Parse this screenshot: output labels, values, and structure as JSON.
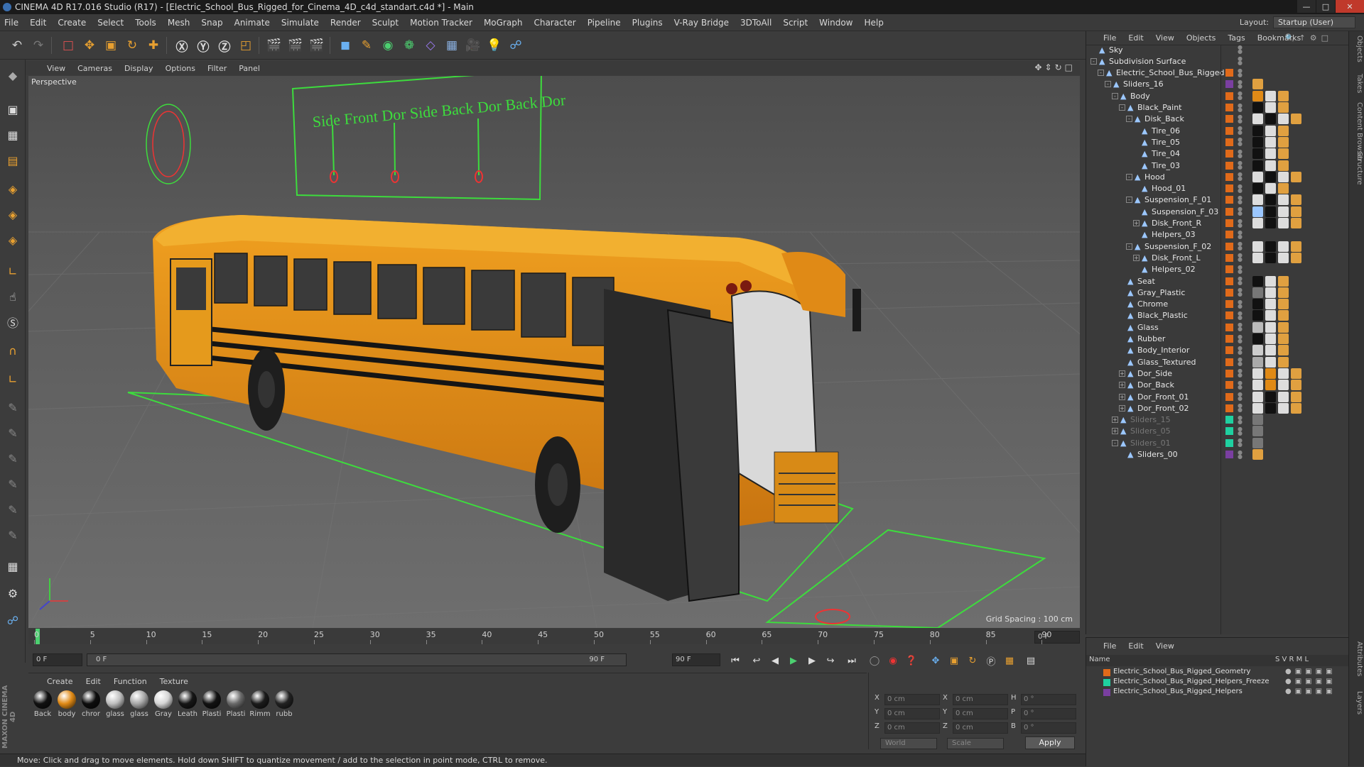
{
  "title": "CINEMA 4D R17.016 Studio (R17) - [Electric_School_Bus_Rigged_for_Cinema_4D_c4d_standart.c4d *] - Main",
  "menubar": [
    "File",
    "Edit",
    "Create",
    "Select",
    "Tools",
    "Mesh",
    "Snap",
    "Animate",
    "Simulate",
    "Render",
    "Sculpt",
    "Motion Tracker",
    "MoGraph",
    "Character",
    "Pipeline",
    "Plugins",
    "V-Ray Bridge",
    "3DToAll",
    "Script",
    "Window",
    "Help"
  ],
  "layout": {
    "label": "Layout:",
    "value": "Startup (User)"
  },
  "viewport": {
    "menu": [
      "View",
      "Cameras",
      "Display",
      "Options",
      "Filter",
      "Panel"
    ],
    "label": "Perspective",
    "grid_spacing": "Grid Spacing : 100 cm",
    "rig_text": "Side Front Dor  Side Back Dor  Back Dor"
  },
  "timeline": {
    "ticks": [
      "0",
      "5",
      "10",
      "15",
      "20",
      "25",
      "30",
      "35",
      "40",
      "45",
      "50",
      "55",
      "60",
      "65",
      "70",
      "75",
      "80",
      "85",
      "90"
    ],
    "end_frame_label": "0 F"
  },
  "transport": {
    "start": "0 F",
    "slider_start": "0 F",
    "slider_end": "90 F",
    "end": "90 F"
  },
  "materials": {
    "menu": [
      "Create",
      "Edit",
      "Function",
      "Texture"
    ],
    "items": [
      {
        "name": "Back",
        "color": "#111111"
      },
      {
        "name": "body",
        "color": "#e08a16"
      },
      {
        "name": "chror",
        "color": "#0d0d0d"
      },
      {
        "name": "glass",
        "color": "#bfbfbf"
      },
      {
        "name": "glass",
        "color": "#a8a8a8"
      },
      {
        "name": "Gray",
        "color": "#d5d5d5"
      },
      {
        "name": "Leath",
        "color": "#161616"
      },
      {
        "name": "Plasti",
        "color": "#121212"
      },
      {
        "name": "Plasti",
        "color": "#6a6a6a"
      },
      {
        "name": "Rimm",
        "color": "#1b1b1b"
      },
      {
        "name": "rubb",
        "color": "#222222"
      }
    ]
  },
  "coordinates": {
    "rows": [
      {
        "a": "X",
        "v1": "0 cm",
        "b": "X",
        "v2": "0 cm",
        "c": "H",
        "v3": "0 °"
      },
      {
        "a": "Y",
        "v1": "0 cm",
        "b": "Y",
        "v2": "0 cm",
        "c": "P",
        "v3": "0 °"
      },
      {
        "a": "Z",
        "v1": "0 cm",
        "b": "Z",
        "v2": "0 cm",
        "c": "B",
        "v3": "0 °"
      }
    ],
    "world": "World",
    "scale": "Scale",
    "apply": "Apply"
  },
  "status": "Move: Click and drag to move elements. Hold down SHIFT to quantize movement / add to the selection in point mode, CTRL to remove.",
  "objects": {
    "menu": [
      "File",
      "Edit",
      "View",
      "Objects",
      "Tags",
      "Bookmarks"
    ],
    "tree": [
      {
        "name": "Sky",
        "depth": 0,
        "exp": "",
        "layer": "",
        "tags": [],
        "dim": false
      },
      {
        "name": "Subdivision Surface",
        "depth": 0,
        "exp": "-",
        "layer": "",
        "tags": [],
        "dim": false
      },
      {
        "name": "Electric_School_Bus_Rigged",
        "depth": 1,
        "exp": "-",
        "layer": "#e06a1a",
        "tags": [],
        "dim": false
      },
      {
        "name": "Sliders_16",
        "depth": 2,
        "exp": "-",
        "layer": "#7a3fa0",
        "tags": [
          "#e0a040"
        ],
        "dim": false
      },
      {
        "name": "Body",
        "depth": 3,
        "exp": "-",
        "layer": "#e06a1a",
        "tags": [
          "#e08a16",
          "#dddddd",
          "#e0a040"
        ],
        "dim": false
      },
      {
        "name": "Black_Paint",
        "depth": 4,
        "exp": "-",
        "layer": "#e06a1a",
        "tags": [
          "#111111",
          "#dddddd",
          "#e0a040"
        ],
        "dim": false
      },
      {
        "name": "Disk_Back",
        "depth": 5,
        "exp": "-",
        "layer": "#e06a1a",
        "tags": [
          "#dddddd",
          "#111111",
          "#dddddd",
          "#e0a040"
        ],
        "dim": false
      },
      {
        "name": "Tire_06",
        "depth": 6,
        "exp": "",
        "layer": "#e06a1a",
        "tags": [
          "#111111",
          "#dddddd",
          "#e0a040"
        ],
        "dim": false
      },
      {
        "name": "Tire_05",
        "depth": 6,
        "exp": "",
        "layer": "#e06a1a",
        "tags": [
          "#111111",
          "#dddddd",
          "#e0a040"
        ],
        "dim": false
      },
      {
        "name": "Tire_04",
        "depth": 6,
        "exp": "",
        "layer": "#e06a1a",
        "tags": [
          "#111111",
          "#dddddd",
          "#e0a040"
        ],
        "dim": false
      },
      {
        "name": "Tire_03",
        "depth": 6,
        "exp": "",
        "layer": "#e06a1a",
        "tags": [
          "#111111",
          "#dddddd",
          "#e0a040"
        ],
        "dim": false
      },
      {
        "name": "Hood",
        "depth": 5,
        "exp": "-",
        "layer": "#e06a1a",
        "tags": [
          "#dddddd",
          "#111111",
          "#dddddd",
          "#e0a040"
        ],
        "dim": false
      },
      {
        "name": "Hood_01",
        "depth": 6,
        "exp": "",
        "layer": "#e06a1a",
        "tags": [
          "#111111",
          "#dddddd",
          "#e0a040"
        ],
        "dim": false
      },
      {
        "name": "Suspension_F_01",
        "depth": 5,
        "exp": "-",
        "layer": "#e06a1a",
        "tags": [
          "#dddddd",
          "#111111",
          "#dddddd",
          "#e0a040"
        ],
        "dim": false
      },
      {
        "name": "Suspension_F_03",
        "depth": 6,
        "exp": "",
        "layer": "#e06a1a",
        "tags": [
          "#9bc7ff",
          "#111111",
          "#dddddd",
          "#e0a040"
        ],
        "dim": false
      },
      {
        "name": "Disk_Front_R",
        "depth": 6,
        "exp": "+",
        "layer": "#e06a1a",
        "tags": [
          "#dddddd",
          "#111111",
          "#dddddd",
          "#e0a040"
        ],
        "dim": false
      },
      {
        "name": "Helpers_03",
        "depth": 6,
        "exp": "",
        "layer": "#e06a1a",
        "tags": [],
        "dim": false
      },
      {
        "name": "Suspension_F_02",
        "depth": 5,
        "exp": "-",
        "layer": "#e06a1a",
        "tags": [
          "#dddddd",
          "#111111",
          "#dddddd",
          "#e0a040"
        ],
        "dim": false
      },
      {
        "name": "Disk_Front_L",
        "depth": 6,
        "exp": "+",
        "layer": "#e06a1a",
        "tags": [
          "#dddddd",
          "#111111",
          "#dddddd",
          "#e0a040"
        ],
        "dim": false
      },
      {
        "name": "Helpers_02",
        "depth": 6,
        "exp": "",
        "layer": "#e06a1a",
        "tags": [],
        "dim": false
      },
      {
        "name": "Seat",
        "depth": 4,
        "exp": "",
        "layer": "#e06a1a",
        "tags": [
          "#111111",
          "#dddddd",
          "#e0a040"
        ],
        "dim": false
      },
      {
        "name": "Gray_Plastic",
        "depth": 4,
        "exp": "",
        "layer": "#e06a1a",
        "tags": [
          "#777777",
          "#dddddd",
          "#e0a040"
        ],
        "dim": false
      },
      {
        "name": "Chrome",
        "depth": 4,
        "exp": "",
        "layer": "#e06a1a",
        "tags": [
          "#111111",
          "#dddddd",
          "#e0a040"
        ],
        "dim": false
      },
      {
        "name": "Black_Plastic",
        "depth": 4,
        "exp": "",
        "layer": "#e06a1a",
        "tags": [
          "#111111",
          "#dddddd",
          "#e0a040"
        ],
        "dim": false
      },
      {
        "name": "Glass",
        "depth": 4,
        "exp": "",
        "layer": "#e06a1a",
        "tags": [
          "#bbbbbb",
          "#dddddd",
          "#e0a040"
        ],
        "dim": false
      },
      {
        "name": "Rubber",
        "depth": 4,
        "exp": "",
        "layer": "#e06a1a",
        "tags": [
          "#111111",
          "#dddddd",
          "#e0a040"
        ],
        "dim": false
      },
      {
        "name": "Body_Interior",
        "depth": 4,
        "exp": "",
        "layer": "#e06a1a",
        "tags": [
          "#cccccc",
          "#dddddd",
          "#e0a040"
        ],
        "dim": false
      },
      {
        "name": "Glass_Textured",
        "depth": 4,
        "exp": "",
        "layer": "#e06a1a",
        "tags": [
          "#aaaaaa",
          "#dddddd",
          "#e0a040"
        ],
        "dim": false
      },
      {
        "name": "Dor_Side",
        "depth": 4,
        "exp": "+",
        "layer": "#e06a1a",
        "tags": [
          "#dddddd",
          "#e08a16",
          "#dddddd",
          "#e0a040"
        ],
        "dim": false
      },
      {
        "name": "Dor_Back",
        "depth": 4,
        "exp": "+",
        "layer": "#e06a1a",
        "tags": [
          "#dddddd",
          "#e08a16",
          "#dddddd",
          "#e0a040"
        ],
        "dim": false
      },
      {
        "name": "Dor_Front_01",
        "depth": 4,
        "exp": "+",
        "layer": "#e06a1a",
        "tags": [
          "#dddddd",
          "#111111",
          "#dddddd",
          "#e0a040"
        ],
        "dim": false
      },
      {
        "name": "Dor_Front_02",
        "depth": 4,
        "exp": "+",
        "layer": "#e06a1a",
        "tags": [
          "#dddddd",
          "#111111",
          "#dddddd",
          "#e0a040"
        ],
        "dim": false
      },
      {
        "name": "Sliders_15",
        "depth": 3,
        "exp": "+",
        "layer": "#1fd0a0",
        "tags": [
          "#777777"
        ],
        "dim": true
      },
      {
        "name": "Sliders_05",
        "depth": 3,
        "exp": "+",
        "layer": "#1fd0a0",
        "tags": [
          "#777777"
        ],
        "dim": true
      },
      {
        "name": "Sliders_01",
        "depth": 3,
        "exp": "-",
        "layer": "#1fd0a0",
        "tags": [
          "#777777"
        ],
        "dim": true
      },
      {
        "name": "Sliders_00",
        "depth": 4,
        "exp": "",
        "layer": "#7a3fa0",
        "tags": [
          "#e0a040"
        ],
        "dim": false
      }
    ]
  },
  "layers": {
    "menu": [
      "File",
      "Edit",
      "View"
    ],
    "header": {
      "name": "Name",
      "cols": "S  V  R  M  L"
    },
    "items": [
      {
        "name": "Electric_School_Bus_Rigged_Geometry",
        "color": "#e06a1a"
      },
      {
        "name": "Electric_School_Bus_Rigged_Helpers_Freeze",
        "color": "#1fd0a0"
      },
      {
        "name": "Electric_School_Bus_Rigged_Helpers",
        "color": "#7a3fa0"
      }
    ]
  },
  "side_tabs": [
    "Objects",
    "Takes",
    "Content Browser",
    "Structure",
    "Attributes",
    "Layers"
  ]
}
